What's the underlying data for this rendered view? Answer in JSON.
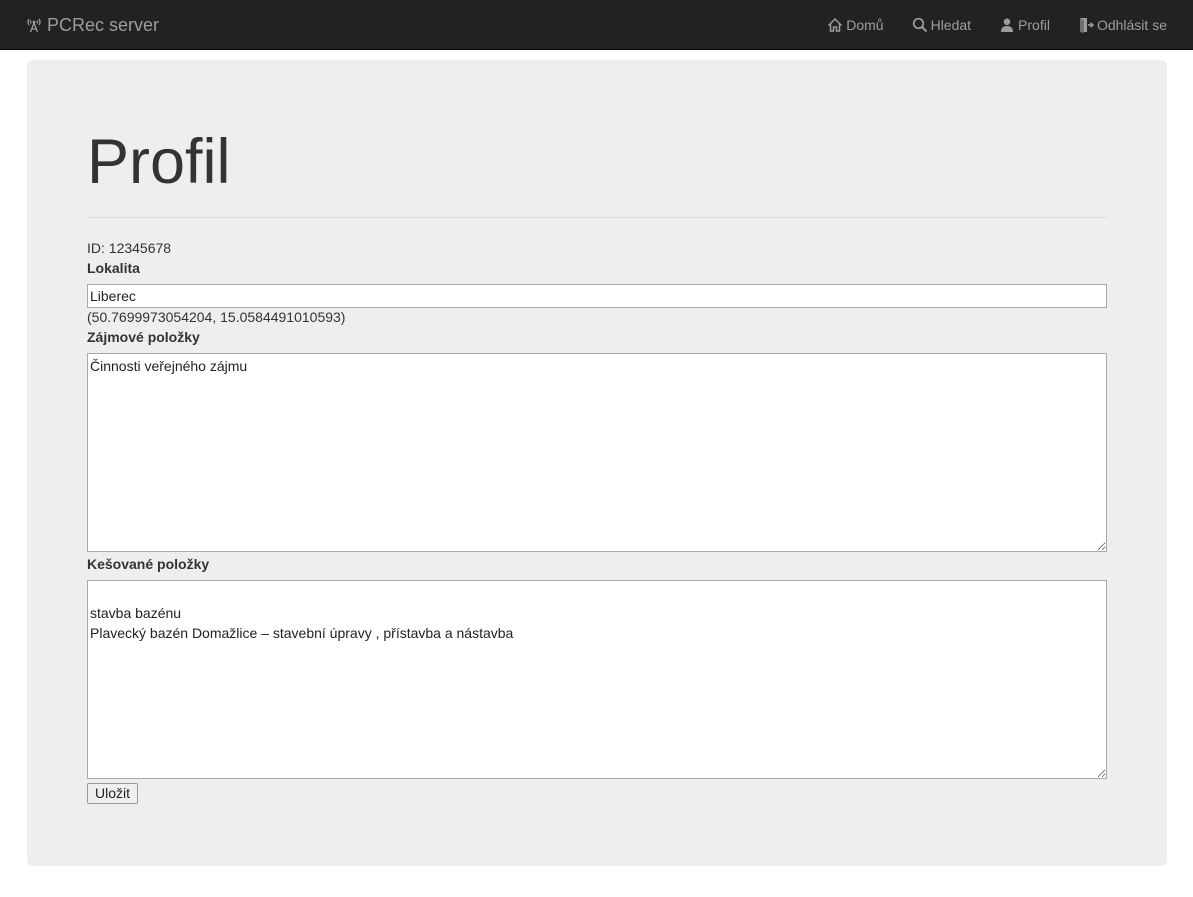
{
  "navbar": {
    "brand": "PCRec server",
    "brand_icon": "broadcast-tower-icon",
    "links": [
      {
        "label": "Domů",
        "icon": "home-icon"
      },
      {
        "label": "Hledat",
        "icon": "search-icon"
      },
      {
        "label": "Profil",
        "icon": "user-icon"
      },
      {
        "label": "Odhlásit se",
        "icon": "logout-icon"
      }
    ]
  },
  "main": {
    "title": "Profil",
    "id_line": "ID: 12345678",
    "location_label": "Lokalita",
    "location_value": "Liberec",
    "coordinates": "(50.7699973054204, 15.0584491010593)",
    "interest_label": "Zájmové položky",
    "interest_value": "Činnosti veřejného zájmu",
    "cached_label": "Kešované položky",
    "cached_value": "\nstavba bazénu\nPlavecký bazén Domažlice – stavební úpravy , přístavba a nástavba",
    "save_label": "Uložit"
  },
  "colors": {
    "navbar_bg": "#222222",
    "navbar_text": "#9d9d9d",
    "panel_bg": "#eeeeee",
    "text": "#333333"
  }
}
